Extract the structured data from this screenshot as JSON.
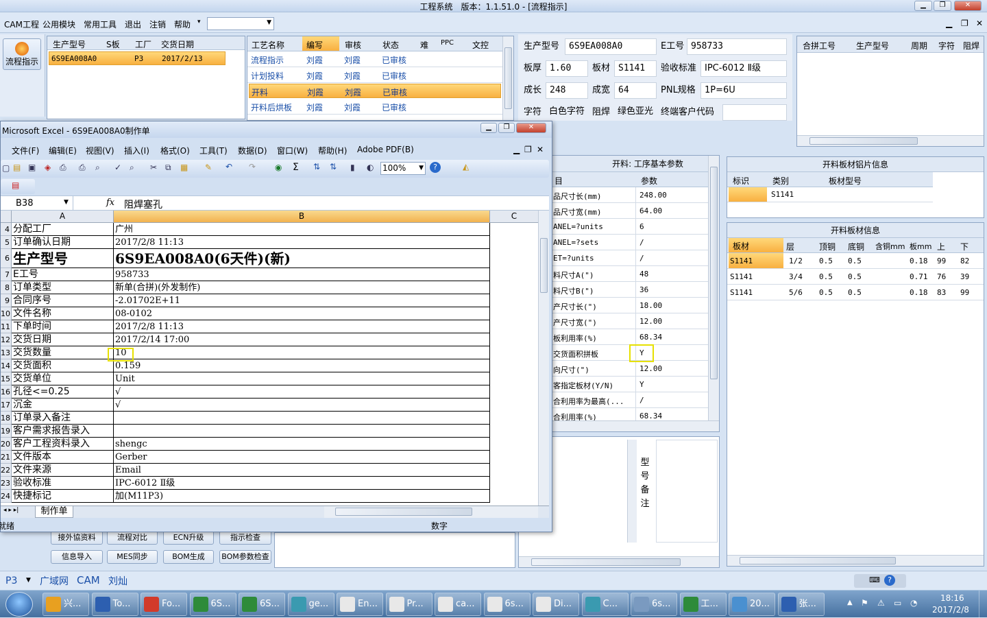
{
  "app": {
    "title": "工程系统　版本：1.1.51.0 - [流程指示]"
  },
  "menubar": {
    "items": [
      "CAM工程",
      "公用模块",
      "常用工具",
      "退出",
      "注销",
      "帮助"
    ]
  },
  "left_button": {
    "label": "流程指示"
  },
  "order_grid": {
    "headers": [
      "生产型号",
      "S板",
      "工厂",
      "交货日期"
    ],
    "row": {
      "model": "6S9EA008A0",
      "factory": "P3",
      "date": "2017/2/13"
    }
  },
  "process_grid": {
    "headers": [
      "工艺名称",
      "编写",
      "审核",
      "状态",
      "难",
      "PPC",
      "文控"
    ],
    "rows": [
      [
        "流程指示",
        "刘霞",
        "刘霞",
        "已审核"
      ],
      [
        "计划投料",
        "刘霞",
        "刘霞",
        "已审核"
      ],
      [
        "开料",
        "刘霞",
        "刘霞",
        "已审核"
      ],
      [
        "开料后烘板",
        "刘霞",
        "刘霞",
        "已审核"
      ]
    ]
  },
  "info": {
    "model_label": "生产型号",
    "model": "6S9EA008A0",
    "e_label": "E工号",
    "e_val": "958733",
    "thick_label": "板厚",
    "thick": "1.60",
    "mat_label": "板材",
    "mat": "S1141",
    "std_label": "验收标准",
    "std": "IPC-6012 Ⅱ级",
    "len_label": "成长",
    "len": "248",
    "wid_label": "成宽",
    "wid": "64",
    "pnl_label": "PNL规格",
    "pnl": "1P=6U",
    "char_label": "字符",
    "char": "白色字符",
    "mask_label": "阻焊",
    "mask": "绿色亚光",
    "cust_label": "终端客户代码"
  },
  "merge_grid": {
    "headers": [
      "合拼工号",
      "生产型号",
      "周期",
      "字符",
      "阻焊"
    ]
  },
  "cut_params": {
    "title": "开料: 工序基本参数",
    "col_item": "目",
    "col_param": "参数",
    "rows": [
      [
        "品尺寸长(mm)",
        "248.00"
      ],
      [
        "品尺寸宽(mm)",
        "64.00"
      ],
      [
        "ANEL=?units",
        "6"
      ],
      [
        "ANEL=?sets",
        "/"
      ],
      [
        "ET=?units",
        "/"
      ],
      [
        "料尺寸A(\")",
        "48"
      ],
      [
        "料尺寸B(\")",
        "36"
      ],
      [
        "产尺寸长(\")",
        "18.00"
      ],
      [
        "产尺寸宽(\")",
        "12.00"
      ],
      [
        "板利用率(%)",
        "68.34"
      ],
      [
        "交货面积拼板",
        "Y"
      ],
      [
        "向尺寸(\")",
        "12.00"
      ],
      [
        "客指定板材(Y/N)",
        "Y"
      ],
      [
        "合利用率为最高(...",
        "/"
      ],
      [
        "合利用率(%)",
        "68.34"
      ]
    ]
  },
  "sheet_info": {
    "title": "开料板材铝片信息",
    "headers": [
      "标识",
      "类别",
      "板材型号"
    ],
    "row": [
      "",
      "S1141",
      ""
    ]
  },
  "board_info": {
    "title": "开料板材信息",
    "headers": [
      "板材",
      "层",
      "顶铜",
      "底铜",
      "含铜mm",
      "板mm",
      "上",
      "下"
    ],
    "rows": [
      [
        "S1141",
        "1/2",
        "0.5",
        "0.5",
        "",
        "0.18",
        "99",
        "82"
      ],
      [
        "S1141",
        "3/4",
        "0.5",
        "0.5",
        "",
        "0.71",
        "76",
        "39"
      ],
      [
        "S1141",
        "5/6",
        "0.5",
        "0.5",
        "",
        "0.18",
        "83",
        "99"
      ]
    ]
  },
  "remark": {
    "label": "型号备注"
  },
  "bottom_buttons": {
    "b1": "接外協资料",
    "b2": "流程对比",
    "b3": "ECN升级",
    "b4": "指示检查",
    "b5": "信息导入",
    "b6": "MES同步",
    "b7": "BOM生成",
    "b8": "BOM参数检查"
  },
  "statusbar": {
    "factory": "P3",
    "items": [
      "广域网",
      "CAM",
      "刘灿"
    ]
  },
  "excel": {
    "title": "Microsoft Excel - 6S9EA008A0制作单",
    "menus": [
      "文件(F)",
      "编辑(E)",
      "视图(V)",
      "插入(I)",
      "格式(O)",
      "工具(T)",
      "数据(D)",
      "窗口(W)",
      "帮助(H)",
      "Adobe PDF(B)"
    ],
    "zoom": "100%",
    "cell_ref": "B38",
    "formula": "阻焊塞孔",
    "col_a": "A",
    "col_b": "B",
    "col_c": "C",
    "sheet_tab": "制作单",
    "status_left": "就绪",
    "status_num": "数字",
    "rows": [
      {
        "n": "4",
        "a": "分配工厂",
        "b": "广州"
      },
      {
        "n": "5",
        "a": "订单确认日期",
        "b": "2017/2/8 11:13"
      },
      {
        "n": "6",
        "a": "生产型号",
        "b": "6S9EA008A0(6天件)(新)"
      },
      {
        "n": "7",
        "a": "E工号",
        "b": "958733"
      },
      {
        "n": "8",
        "a": "订单类型",
        "b": "新单(合拼)(外发制作)"
      },
      {
        "n": "9",
        "a": "合同序号",
        "b": "-2.01702E+11"
      },
      {
        "n": "10",
        "a": "文件名称",
        "b": "08-0102"
      },
      {
        "n": "11",
        "a": "下单时间",
        "b": "2017/2/8 11:13"
      },
      {
        "n": "12",
        "a": "交货日期",
        "b": "2017/2/14 17:00"
      },
      {
        "n": "13",
        "a": "交货数量",
        "b": "10"
      },
      {
        "n": "14",
        "a": "交货面积",
        "b": "0.159"
      },
      {
        "n": "15",
        "a": "交货单位",
        "b": "Unit"
      },
      {
        "n": "16",
        "a": "孔径<=0.25",
        "b": "√"
      },
      {
        "n": "17",
        "a": "沉金",
        "b": "√"
      },
      {
        "n": "18",
        "a": "订单录入备注",
        "b": ""
      },
      {
        "n": "19",
        "a": "客户需求报告录入",
        "b": ""
      },
      {
        "n": "20",
        "a": "客户工程资料录入",
        "b": "shengc"
      },
      {
        "n": "21",
        "a": "文件版本",
        "b": "Gerber"
      },
      {
        "n": "22",
        "a": "文件来源",
        "b": "Email"
      },
      {
        "n": "23",
        "a": "验收标准",
        "b": "IPC-6012 Ⅱ级"
      },
      {
        "n": "24",
        "a": "快捷标记",
        "b": "加(M11P3)"
      }
    ]
  },
  "taskbar": {
    "items": [
      "兴...",
      "To...",
      "Fo...",
      "6S...",
      "6S...",
      "ge...",
      "En...",
      "Pr...",
      "ca...",
      "6s...",
      "Di...",
      "C...",
      "6s...",
      "工...",
      "20...",
      "张..."
    ],
    "time": "18:16",
    "date": "2017/2/8"
  }
}
